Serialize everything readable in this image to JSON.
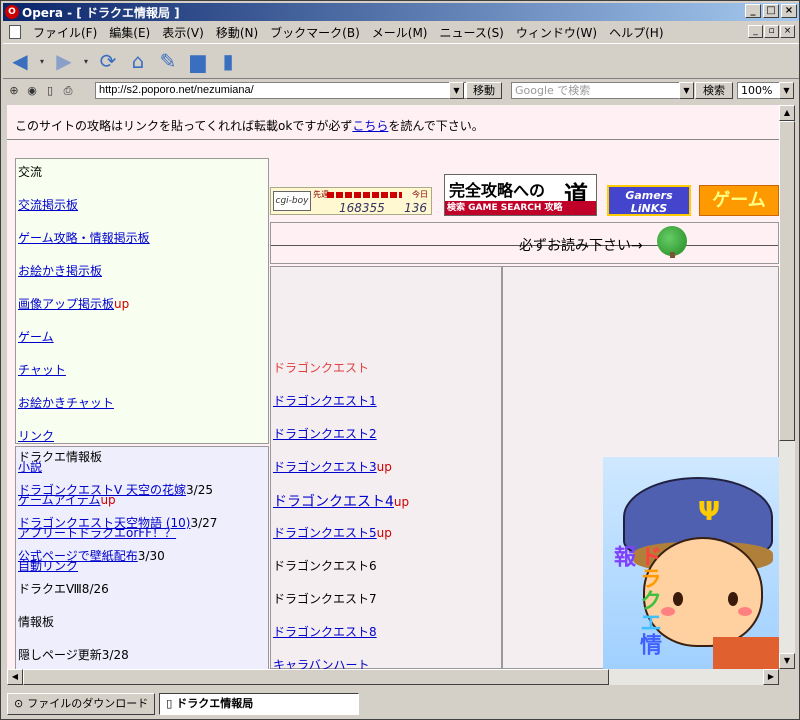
{
  "window": {
    "title": "Opera - [ ドラクエ情報局 ]",
    "app_icon": "opera-icon"
  },
  "menu": [
    "ファイル(F)",
    "編集(E)",
    "表示(V)",
    "移動(N)",
    "ブックマーク(B)",
    "メール(M)",
    "ニュース(S)",
    "ウィンドウ(W)",
    "ヘルプ(H)"
  ],
  "address": {
    "url": "http://s2.poporo.net/nezumiana/",
    "go_label": "移動",
    "search_placeholder": "Google で検索",
    "search_label": "検索",
    "zoom": "100%"
  },
  "page": {
    "top_note": {
      "before": "このサイトの攻略はリンクを貼ってくれれば転載okですが必ず",
      "link": "こちら",
      "after": "を読んで下さい。"
    },
    "panel1": {
      "heading": "交流",
      "items": [
        "交流掲示板",
        "ゲーム攻略・情報掲示板",
        "お絵かき掲示板",
        "画像アップ掲示板",
        "ゲーム",
        "チャット",
        "お絵かきチャット",
        "リンク"
      ],
      "up_tag": "up"
    },
    "panel2": {
      "heading": "ドラクエ情報板",
      "novel": "小説",
      "dq5": "ドラゴンクエストV 天空の花嫁",
      "dq5_date": "3/25",
      "game_item": "ゲームアイテム",
      "up_tag": "up",
      "tenku": "ドラゴンクエスト天空物語 (10)",
      "tenku_date": "3/27",
      "apr": "アプリートドラクエorFF！？",
      "wall": "公式ページで壁紙配布",
      "wall_date": "3/30",
      "auto": "自動リンク",
      "dq8": "ドラクエⅧ8/26",
      "info": "情報板",
      "hidden": "隠しページ更新3/28"
    },
    "counter": {
      "logo": "cgi-boy",
      "label_total": "先週",
      "label_today": "今日",
      "total": "168355",
      "today": "136"
    },
    "banner1": {
      "title": "完全攻略への",
      "michi": "道",
      "bar": "検索 GAME SEARCH 攻略"
    },
    "banner2": {
      "line1": "Gamers",
      "line2": "LiNKS"
    },
    "banner3": {
      "text": "ゲーム"
    },
    "notice": "必ずお読み下さい→",
    "mid": {
      "current": "ドラゴンクエスト",
      "items": [
        "ドラゴンクエスト1",
        "ドラゴンクエスト2",
        "ドラゴンクエスト3",
        "ドラゴンクエスト4",
        "ドラゴンクエスト5",
        "ドラゴンクエスト6",
        "ドラゴンクエスト7",
        "ドラゴンクエスト8",
        "キャラバンハート"
      ],
      "up_tag": "up"
    },
    "art_text": [
      "ド",
      "ラ",
      "ク",
      "エ",
      "情",
      "報"
    ]
  },
  "status": {
    "download": "ファイルのダウンロード",
    "tab": "ドラクエ情報局"
  }
}
